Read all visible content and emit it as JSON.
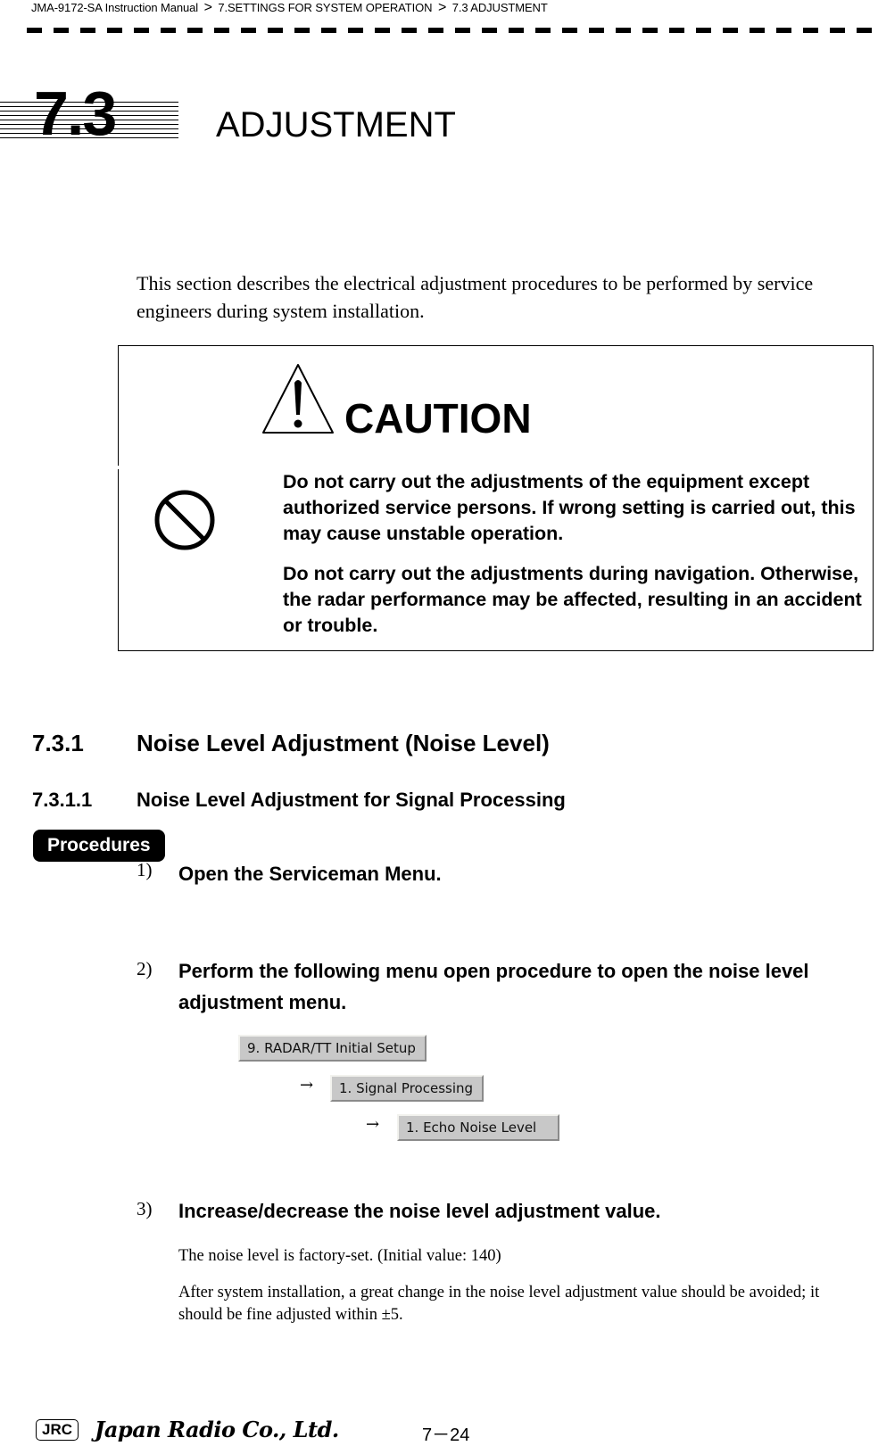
{
  "breadcrumb": {
    "items": [
      "JMA-9172-SA Instruction Manual",
      "7.SETTINGS FOR SYSTEM OPERATION",
      "7.3  ADJUSTMENT"
    ],
    "separator": ">"
  },
  "chapter": {
    "number": "7.3",
    "title": "ADJUSTMENT"
  },
  "intro": "This section describes the electrical adjustment procedures to be performed by service engineers during system installation.",
  "caution": {
    "heading": "CAUTION",
    "icons": [
      "warning-triangle-icon",
      "prohibition-icon"
    ],
    "paragraphs": [
      "Do not carry out the adjustments of the equipment except authorized service persons. If wrong setting is carried out, this may cause unstable operation.",
      "Do not carry out the adjustments during navigation. Otherwise, the radar performance may be affected, resulting in an accident or trouble."
    ]
  },
  "section": {
    "number": "7.3.1",
    "title": "Noise Level Adjustment (Noise Level)"
  },
  "subsection": {
    "number": "7.3.1.1",
    "title": "Noise Level Adjustment for Signal Processing"
  },
  "procedures_label": "Procedures",
  "steps": [
    {
      "num": "1)",
      "text": "Open the Serviceman Menu."
    },
    {
      "num": "2)",
      "text": "Perform the following menu open procedure to open the noise level adjustment menu."
    },
    {
      "num": "3)",
      "text": "Increase/decrease the noise level adjustment value."
    }
  ],
  "menu_path": {
    "arrow": "→",
    "items": [
      "9. RADAR/TT Initial Setup",
      "1. Signal Processing",
      "1. Echo Noise Level"
    ]
  },
  "step3_notes": [
    "The noise level is factory-set. (Initial value: 140)",
    "After system installation, a great change in the noise level adjustment value should be avoided; it should be fine adjusted within ±5."
  ],
  "footer": {
    "logo_text": "JRC",
    "company": "Japan Radio Co., Ltd.",
    "page": "7－24"
  }
}
